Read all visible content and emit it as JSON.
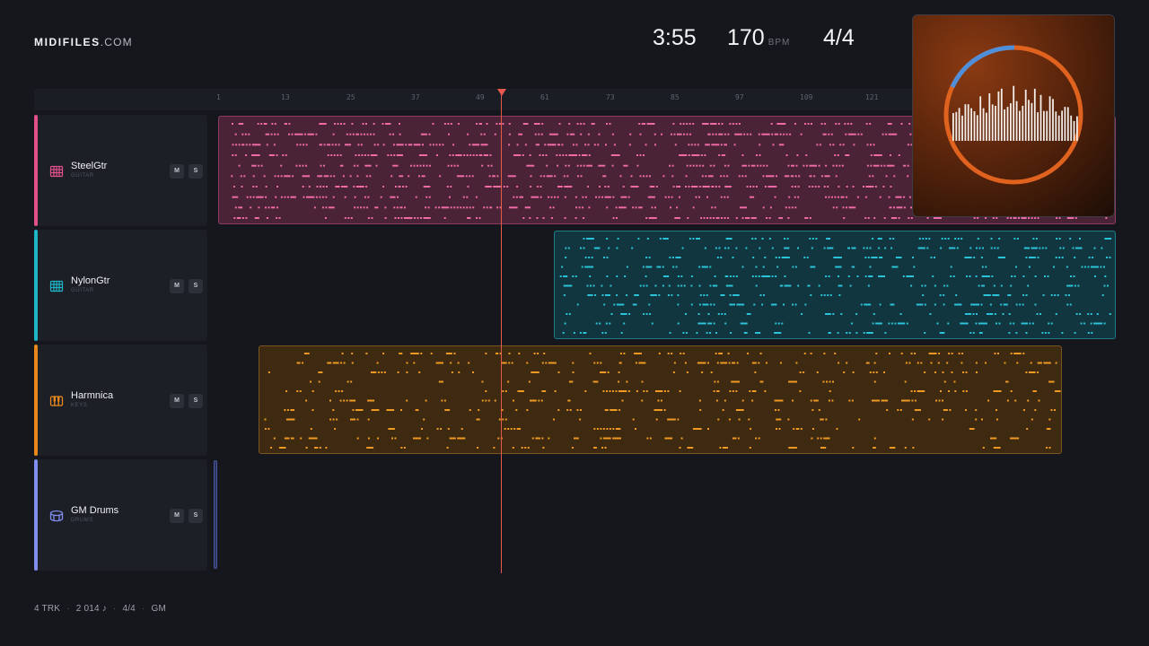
{
  "brand": {
    "name": "MIDIFILES",
    "tld": ".COM"
  },
  "transport": {
    "time": "3:55",
    "tempo": "170",
    "tempo_unit": "BPM",
    "signature": "4/4"
  },
  "ruler": {
    "ticks": [
      "1",
      "13",
      "25",
      "37",
      "49",
      "61",
      "73",
      "85",
      "97",
      "109",
      "121"
    ]
  },
  "tracks": [
    {
      "name": "SteelGtr",
      "category": "GUITAR",
      "icon": "guitar-grid-icon",
      "color": "#e0508a",
      "mute": "M",
      "solo": "S"
    },
    {
      "name": "NylonGtr",
      "category": "GUITAR",
      "icon": "guitar-grid-icon",
      "color": "#1fb5c9",
      "mute": "M",
      "solo": "S"
    },
    {
      "name": "Harmnica",
      "category": "KEYS",
      "icon": "keys-icon",
      "color": "#e8871c",
      "mute": "M",
      "solo": "S"
    },
    {
      "name": "GM Drums",
      "category": "DRUMS",
      "icon": "drum-icon",
      "color": "#7f8cf0",
      "mute": "M",
      "solo": "S"
    }
  ],
  "footer": {
    "tracks": "4 TRK",
    "notes": "2 014 ♪",
    "signature": "4/4",
    "standard": "GM"
  },
  "colors": {
    "background": "#15171c",
    "playhead": "#e8594d",
    "accent_orange": "#e0621f",
    "accent_blue": "#4f8ed8"
  }
}
